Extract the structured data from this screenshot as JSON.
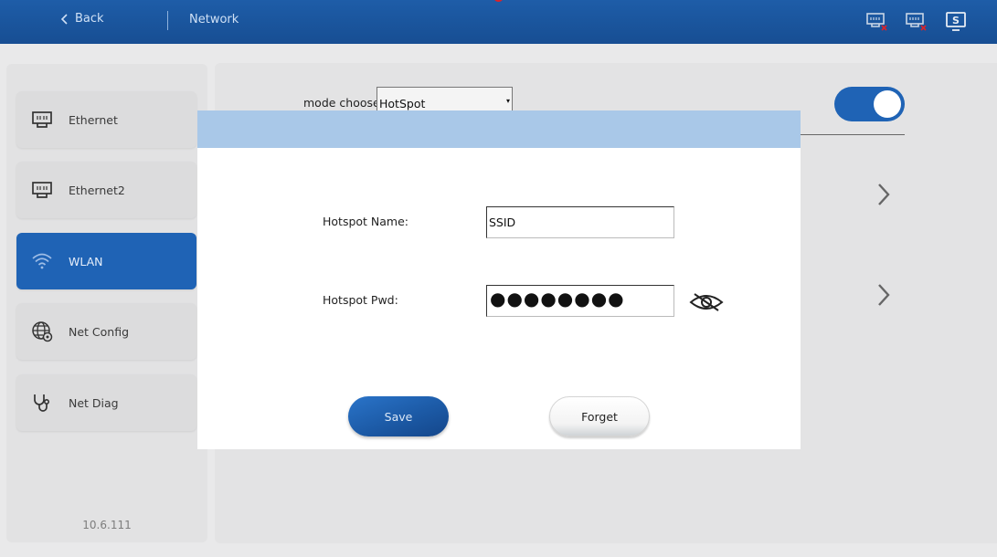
{
  "header": {
    "back_label": "Back",
    "title": "Network",
    "status_icons": [
      "ethernet-disconnected-icon",
      "ethernet2-disconnected-icon",
      "screen-s-icon"
    ]
  },
  "sidebar": {
    "items": [
      {
        "label": "Ethernet",
        "icon": "ethernet-port-icon",
        "active": false
      },
      {
        "label": "Ethernet2",
        "icon": "ethernet-port-icon",
        "active": false
      },
      {
        "label": "WLAN",
        "icon": "wifi-icon",
        "active": true
      },
      {
        "label": "Net Config",
        "icon": "globe-gear-icon",
        "active": false
      },
      {
        "label": "Net Diag",
        "icon": "stethoscope-icon",
        "active": false
      }
    ],
    "version": "10.6.111"
  },
  "main": {
    "mode_label": "mode choose:",
    "mode_value": "HotSpot",
    "toggle_on": true
  },
  "modal": {
    "hotspot_name_label": "Hotspot Name:",
    "hotspot_name_value": "SSID",
    "hotspot_pwd_label": "Hotspot Pwd:",
    "hotspot_pwd_value": "●●●●●●●●",
    "save_label": "Save",
    "forget_label": "Forget"
  },
  "colors": {
    "header_bg": "#1a539a",
    "accent": "#1f63b5",
    "modal_header": "#a9c8e8",
    "status_red": "#d9242b"
  }
}
